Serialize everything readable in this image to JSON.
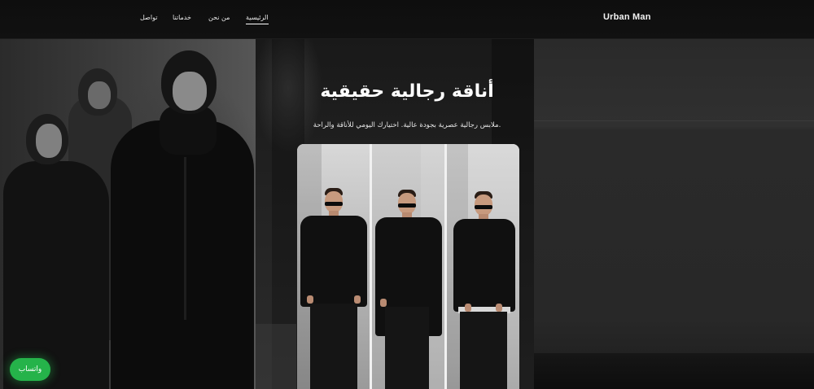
{
  "header": {
    "brand": "Urban Man",
    "nav": [
      {
        "label": "الرئيسية",
        "active": true
      },
      {
        "label": "من نحن",
        "active": false
      },
      {
        "label": "خدماتنا",
        "active": false
      },
      {
        "label": "تواصل",
        "active": false
      }
    ]
  },
  "hero": {
    "title": "أناقة رجالية حقيقية",
    "subtitle": "ملابس رجالية عصرية بجودة عالية. اختيارك اليومي للأناقة والراحة."
  },
  "floating": {
    "whatsapp_label": "واتساب",
    "whatsapp_color": "#25b34a"
  }
}
